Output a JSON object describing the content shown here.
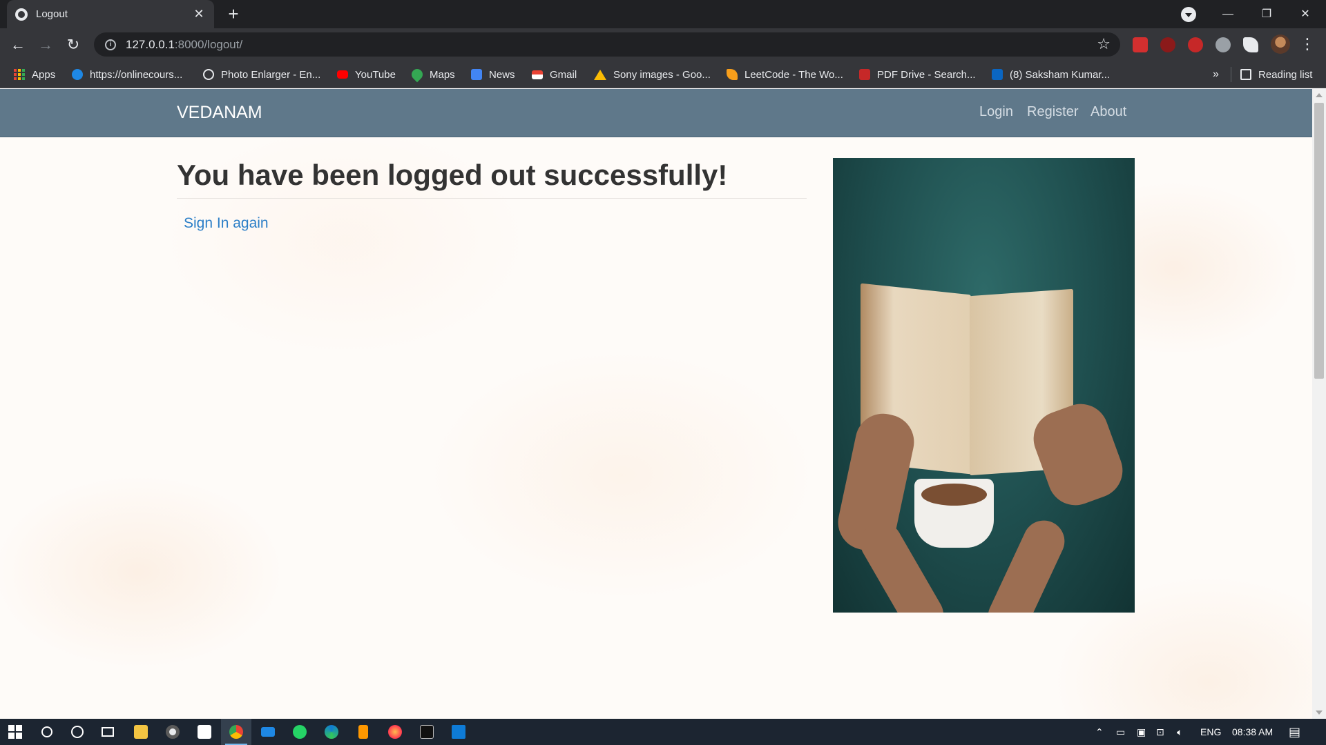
{
  "browser": {
    "tab_title": "Logout",
    "tab_close": "✕",
    "new_tab": "+",
    "url_host": "127.0.0.1",
    "url_path": ":8000/logout/",
    "bookmarks": [
      {
        "label": "Apps",
        "icon": "apps-grid-icon"
      },
      {
        "label": "https://onlinecours...",
        "icon": "globe-icon",
        "color": "#1e88e5"
      },
      {
        "label": "Photo Enlarger - En...",
        "icon": "magnifier-icon",
        "color": "#e8eaed"
      },
      {
        "label": "YouTube",
        "icon": "youtube-icon",
        "color": "#ff0000"
      },
      {
        "label": "Maps",
        "icon": "maps-icon",
        "color": "#34a853"
      },
      {
        "label": "News",
        "icon": "news-icon",
        "color": "#4285f4"
      },
      {
        "label": "Gmail",
        "icon": "gmail-icon",
        "color": "#ea4335"
      },
      {
        "label": "Sony images - Goo...",
        "icon": "drive-icon",
        "color": "#fbbc04"
      },
      {
        "label": "LeetCode - The Wo...",
        "icon": "leetcode-icon",
        "color": "#f89f1b"
      },
      {
        "label": "PDF Drive - Search...",
        "icon": "pdf-icon",
        "color": "#c62828"
      },
      {
        "label": "(8) Saksham Kumar...",
        "icon": "linkedin-icon",
        "color": "#0a66c2"
      }
    ],
    "bookmarks_more": "»",
    "reading_list": "Reading list"
  },
  "site": {
    "brand": "VEDANAM",
    "nav": {
      "login": "Login",
      "register": "Register",
      "about": "About"
    },
    "heading": "You have been logged out successfully!",
    "signin_link": "Sign In again",
    "image": "book-and-coffee-photo"
  },
  "taskbar": {
    "language": "ENG",
    "time": "08:38 AM"
  }
}
